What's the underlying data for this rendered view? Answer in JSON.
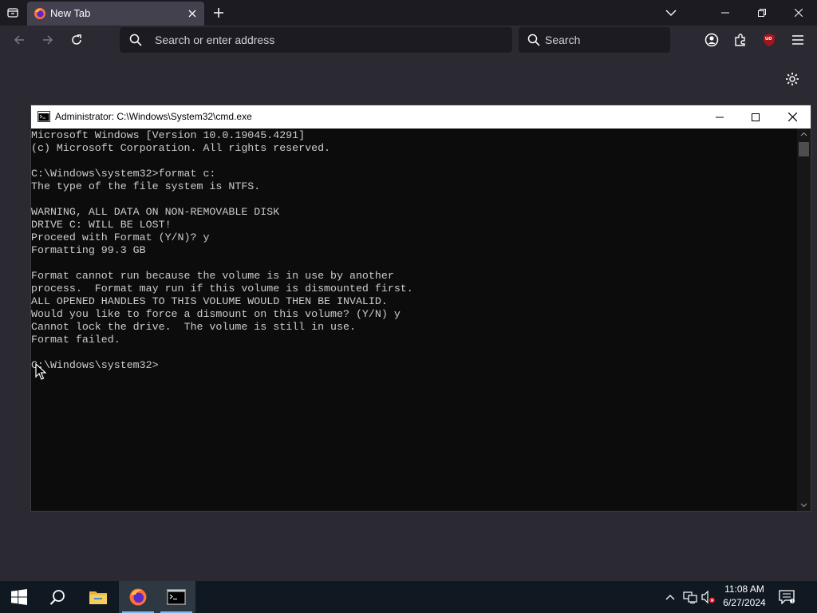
{
  "browser": {
    "tab_title": "New Tab",
    "url_placeholder": "Search or enter address",
    "search_placeholder": "Search",
    "addon_badge": "uo"
  },
  "cmd": {
    "title": "Administrator: C:\\Windows\\System32\\cmd.exe",
    "lines": [
      "Microsoft Windows [Version 10.0.19045.4291]",
      "(c) Microsoft Corporation. All rights reserved.",
      "",
      "C:\\Windows\\system32>format c:",
      "The type of the file system is NTFS.",
      "",
      "WARNING, ALL DATA ON NON-REMOVABLE DISK",
      "DRIVE C: WILL BE LOST!",
      "Proceed with Format (Y/N)? y",
      "Formatting 99.3 GB",
      "",
      "Format cannot run because the volume is in use by another",
      "process.  Format may run if this volume is dismounted first.",
      "ALL OPENED HANDLES TO THIS VOLUME WOULD THEN BE INVALID.",
      "Would you like to force a dismount on this volume? (Y/N) y",
      "Cannot lock the drive.  The volume is still in use.",
      "Format failed.",
      "",
      "C:\\Windows\\system32>"
    ]
  },
  "taskbar": {
    "time": "11:08 AM",
    "date": "6/27/2024"
  },
  "colors": {
    "accent": "#76b9ed",
    "ublock_red": "#a3141c"
  }
}
